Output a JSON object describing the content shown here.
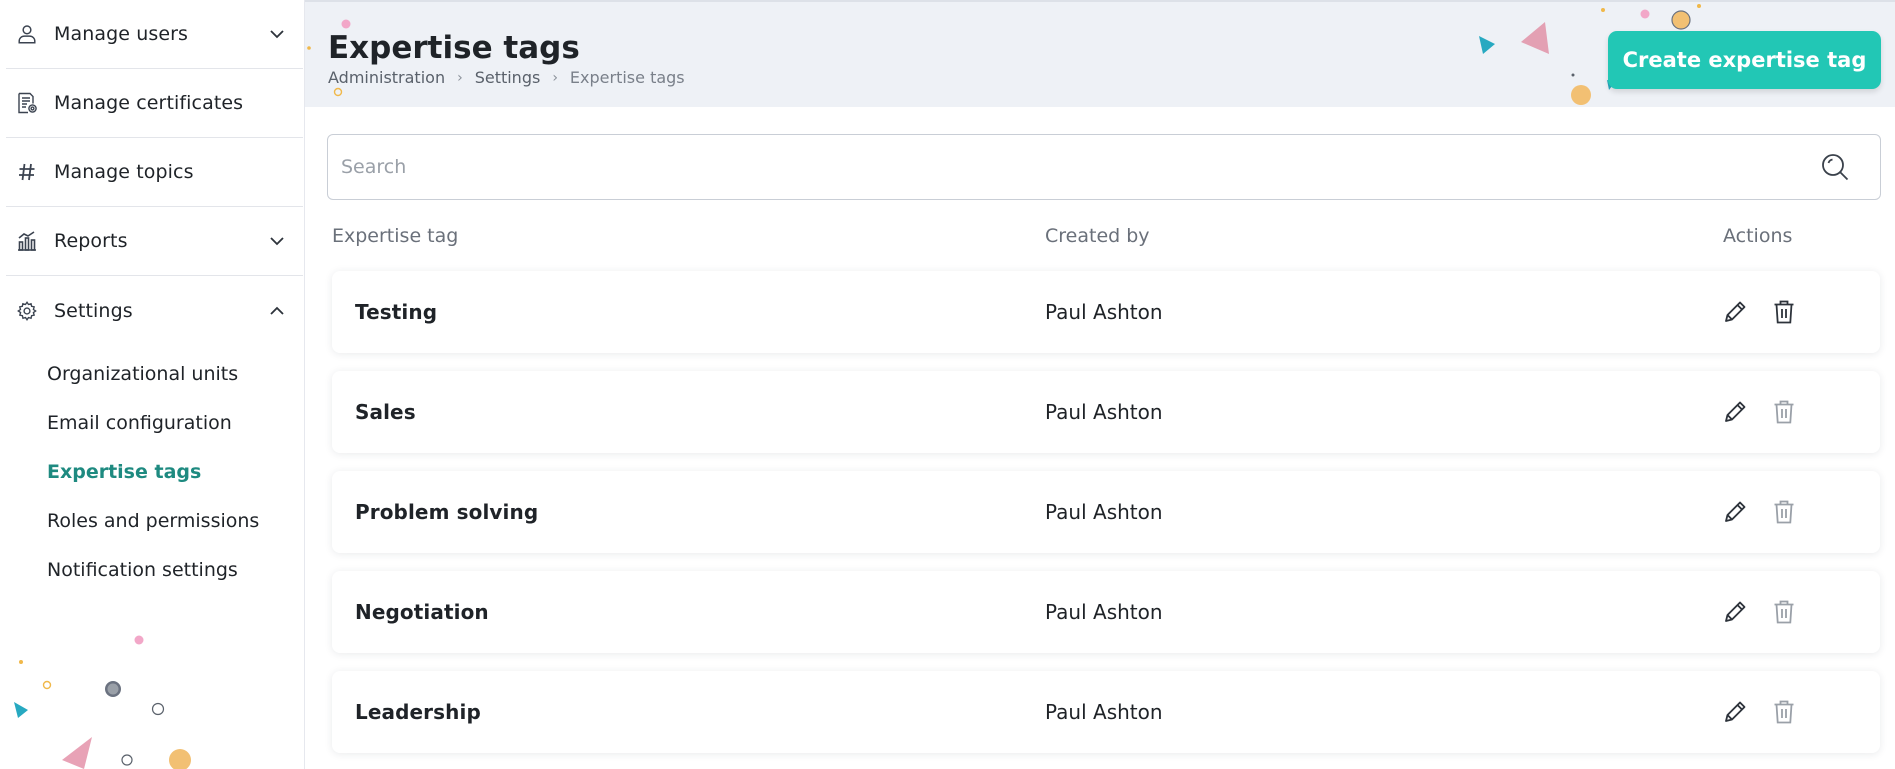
{
  "sidebar": {
    "items": [
      {
        "label": "Manage users",
        "icon": "user-icon",
        "expandable": true,
        "expanded": false
      },
      {
        "label": "Manage certificates",
        "icon": "certificate-icon",
        "expandable": false
      },
      {
        "label": "Manage topics",
        "icon": "hashtag-icon",
        "expandable": false
      },
      {
        "label": "Reports",
        "icon": "bar-chart-icon",
        "expandable": true,
        "expanded": false
      },
      {
        "label": "Settings",
        "icon": "gear-icon",
        "expandable": true,
        "expanded": true
      }
    ],
    "settings_sub": [
      {
        "label": "Organizational units",
        "active": false
      },
      {
        "label": "Email configuration",
        "active": false
      },
      {
        "label": "Expertise tags",
        "active": true
      },
      {
        "label": "Roles and permissions",
        "active": false
      },
      {
        "label": "Notification settings",
        "active": false
      }
    ]
  },
  "header": {
    "title": "Expertise tags",
    "breadcrumb": [
      "Administration",
      "Settings",
      "Expertise tags"
    ],
    "create_button_label": "Create expertise tag"
  },
  "search": {
    "placeholder": "Search",
    "value": ""
  },
  "table": {
    "columns": [
      "Expertise tag",
      "Created by",
      "Actions"
    ],
    "rows": [
      {
        "tag": "Testing",
        "created_by": "Paul Ashton"
      },
      {
        "tag": "Sales",
        "created_by": "Paul Ashton"
      },
      {
        "tag": "Problem solving",
        "created_by": "Paul Ashton"
      },
      {
        "tag": "Negotiation",
        "created_by": "Paul Ashton"
      },
      {
        "tag": "Leadership",
        "created_by": "Paul Ashton"
      }
    ]
  },
  "colors": {
    "accent": "#22c7b5",
    "active_nav": "#1e8a80",
    "header_bg": "#eef1f6",
    "delete_enabled": "#2d333b",
    "delete_disabled": "#9aa0a8"
  }
}
